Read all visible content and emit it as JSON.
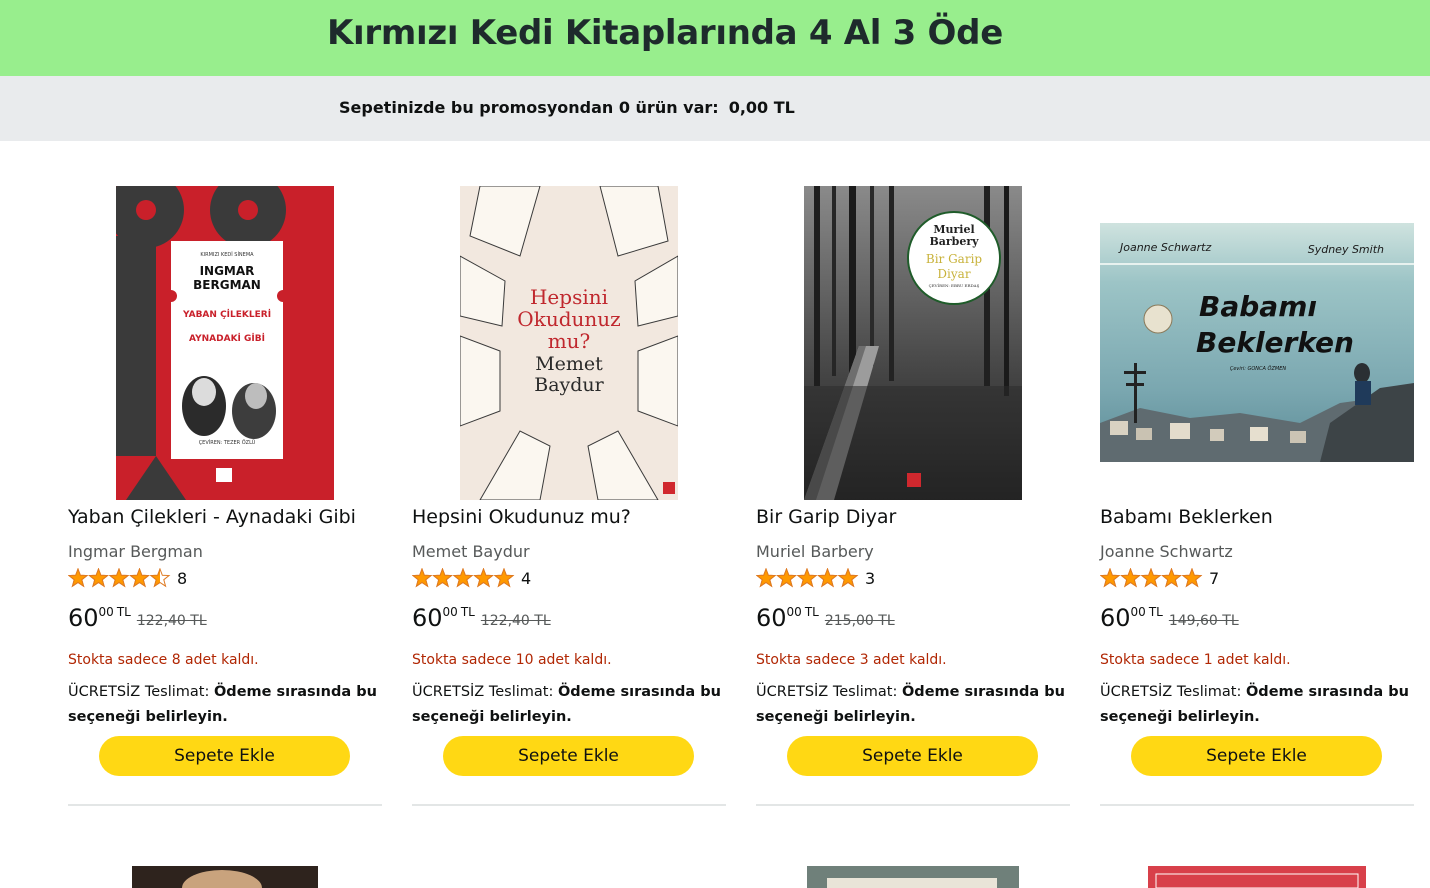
{
  "promo": {
    "title": "Kırmızı Kedi Kitaplarında 4 Al 3 Öde",
    "cart_text": "Sepetinizde bu promosyondan 0 ürün var:",
    "cart_amount": "0,00 TL"
  },
  "colors": {
    "banner": "#98ee8d",
    "cart_bar": "#e9ebed",
    "star": "#ff9900",
    "stock_red": "#b12704",
    "button": "#ffd814"
  },
  "products": [
    {
      "title": "Yaban Çilekleri - Aynadaki Gibi",
      "author": "Ingmar Bergman",
      "rating": 4.5,
      "rating_count": "8",
      "price_whole": "60",
      "price_fraction": "00",
      "currency": "TL",
      "old_price": "122,40 TL",
      "stock": "Stokta sadece 8 adet kaldı.",
      "delivery_label": "ÜCRETSİZ Teslimat:",
      "delivery_detail": "Ödeme sırasında bu seçeneği belirleyin.",
      "button": "Sepete Ekle",
      "cover": {
        "series": "KIRMIZI KEDİ SİNEMA",
        "author": "INGMAR BERGMAN",
        "title1": "YABAN ÇİLEKLERİ",
        "title2": "AYNADAKİ GİBİ",
        "translator": "ÇEVİREN: TEZER ÖZLÜ"
      }
    },
    {
      "title": "Hepsini Okudunuz mu?",
      "author": "Memet Baydur",
      "rating": 5,
      "rating_count": "4",
      "price_whole": "60",
      "price_fraction": "00",
      "currency": "TL",
      "old_price": "122,40 TL",
      "stock": "Stokta sadece 10 adet kaldı.",
      "delivery_label": "ÜCRETSİZ Teslimat:",
      "delivery_detail": "Ödeme sırasında bu seçeneği belirleyin.",
      "button": "Sepete Ekle",
      "cover": {
        "title1": "Hepsini",
        "title2": "Okudunuz",
        "title3": "mu?",
        "author1": "Memet",
        "author2": "Baydur"
      }
    },
    {
      "title": "Bir Garip Diyar",
      "author": "Muriel Barbery",
      "rating": 5,
      "rating_count": "3",
      "price_whole": "60",
      "price_fraction": "00",
      "currency": "TL",
      "old_price": "215,00 TL",
      "stock": "Stokta sadece 3 adet kaldı.",
      "delivery_label": "ÜCRETSİZ Teslimat:",
      "delivery_detail": "Ödeme sırasında bu seçeneği belirleyin.",
      "button": "Sepete Ekle",
      "cover": {
        "author1": "Muriel",
        "author2": "Barbery",
        "title1": "Bir Garip",
        "title2": "Diyar",
        "translator": "ÇEVİREN: EBRU ERDAŞ"
      }
    },
    {
      "title": "Babamı Beklerken",
      "author": "Joanne Schwartz",
      "rating": 5,
      "rating_count": "7",
      "price_whole": "60",
      "price_fraction": "00",
      "currency": "TL",
      "old_price": "149,60 TL",
      "stock": "Stokta sadece 1 adet kaldı.",
      "delivery_label": "ÜCRETSİZ Teslimat:",
      "delivery_detail": "Ödeme sırasında bu seçeneği belirleyin.",
      "button": "Sepete Ekle",
      "cover": {
        "author": "Joanne Schwartz",
        "illustrator": "Sydney Smith",
        "title1": "Babamı",
        "title2": "Beklerken",
        "translator": "Çeviri: GONCA ÖZMEN"
      }
    }
  ]
}
